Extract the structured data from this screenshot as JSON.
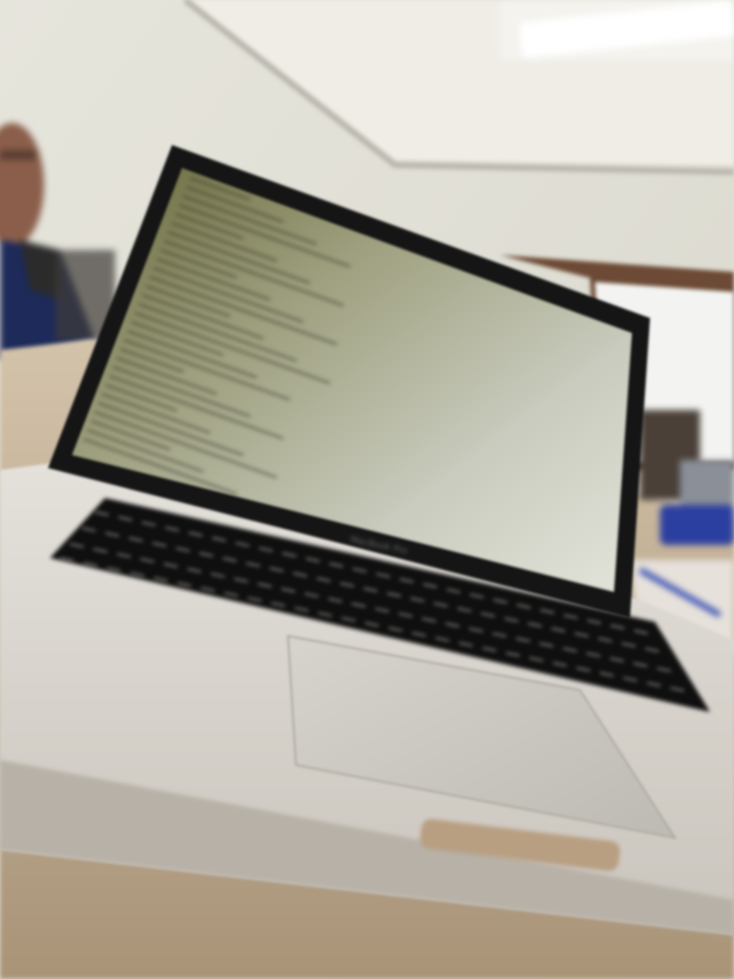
{
  "scene": {
    "subject": "laptop-on-desk",
    "motion_blur": true,
    "colors": {
      "wall": "#e9e6dd",
      "ceiling": "#f1efe8",
      "ceiling_light": "#ffffff",
      "desk": "#c6b49c",
      "laptop_body": "#d9d6d0",
      "laptop_bezel": "#151515",
      "screen": "#c9cbbd",
      "keyboard": "#111111",
      "trackpad": "#cfccc6",
      "window_frame": "#6c4a35",
      "person_shirt": "#1d2a5a"
    }
  },
  "screen": {
    "content": "terminal-text-lines",
    "text_lines": 30
  }
}
